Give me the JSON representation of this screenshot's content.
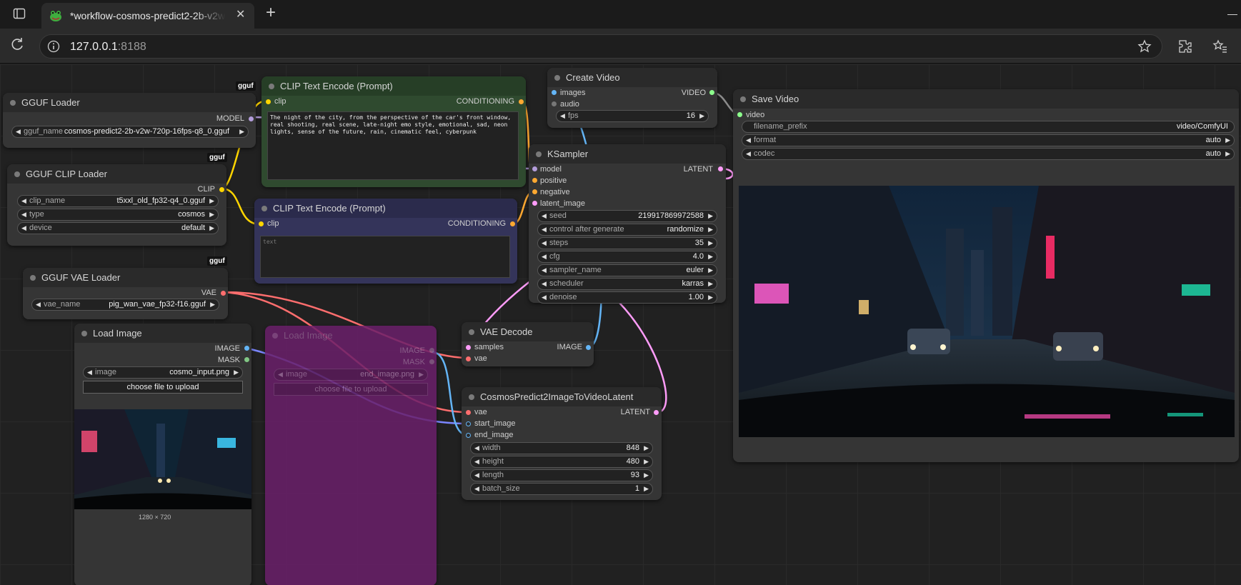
{
  "browser": {
    "tab_title": "*workflow-cosmos-predict2-2b-v2w",
    "url_host": "127.0.0.1",
    "url_port": ":8188",
    "icons": [
      "sidebar-toggle-icon",
      "frog-favicon-icon",
      "close-tab-icon",
      "new-tab-icon",
      "minimize-icon",
      "reload-icon",
      "site-info-icon",
      "bookmark-star-icon",
      "extensions-icon",
      "favorites-icon"
    ]
  },
  "nodes": {
    "gguf_loader": {
      "title": "GGUF Loader",
      "badge": "gguf",
      "out_model": "MODEL",
      "gguf_name_label": "gguf_name",
      "gguf_name_value": "cosmos-predict2-2b-v2w-720p-16fps-q8_0.gguf"
    },
    "clip_loader": {
      "title": "GGUF CLIP Loader",
      "badge": "gguf",
      "out_clip": "CLIP",
      "clip_name_label": "clip_name",
      "clip_name_value": "t5xxl_old_fp32-q4_0.gguf",
      "type_label": "type",
      "type_value": "cosmos",
      "device_label": "device",
      "device_value": "default"
    },
    "vae_loader": {
      "title": "GGUF VAE Loader",
      "badge": "gguf",
      "out_vae": "VAE",
      "vae_name_label": "vae_name",
      "vae_name_value": "pig_wan_vae_fp32-f16.gguf"
    },
    "clip_pos": {
      "title": "CLIP Text Encode (Prompt)",
      "badge": "gguf",
      "in_clip": "clip",
      "out_cond": "CONDITIONING",
      "text": "The night of the city, from the perspective of the car's front window, real shooting, real scene, late-night emo style, emotional, sad, neon lights, sense of the future, rain, cinematic feel, cyberpunk"
    },
    "clip_neg": {
      "title": "CLIP Text Encode (Prompt)",
      "in_clip": "clip",
      "out_cond": "CONDITIONING",
      "placeholder": "text"
    },
    "create_video": {
      "title": "Create Video",
      "in_images": "images",
      "in_audio": "audio",
      "out_video": "VIDEO",
      "fps_label": "fps",
      "fps_value": "16"
    },
    "ksampler": {
      "title": "KSampler",
      "in_model": "model",
      "in_positive": "positive",
      "in_negative": "negative",
      "in_latent": "latent_image",
      "out_latent": "LATENT",
      "seed_label": "seed",
      "seed_value": "219917869972588",
      "cag_label": "control after generate",
      "cag_value": "randomize",
      "steps_label": "steps",
      "steps_value": "35",
      "cfg_label": "cfg",
      "cfg_value": "4.0",
      "sampler_label": "sampler_name",
      "sampler_value": "euler",
      "scheduler_label": "scheduler",
      "scheduler_value": "karras",
      "denoise_label": "denoise",
      "denoise_value": "1.00"
    },
    "save_video": {
      "title": "Save Video",
      "in_video": "video",
      "prefix_label": "filename_prefix",
      "prefix_value": "video/ComfyUI",
      "format_label": "format",
      "format_value": "auto",
      "codec_label": "codec",
      "codec_value": "auto"
    },
    "load_image": {
      "title": "Load Image",
      "out_image": "IMAGE",
      "out_mask": "MASK",
      "image_label": "image",
      "image_value": "cosmo_input.png",
      "upload_label": "choose file to upload",
      "dims": "1280 × 720"
    },
    "load_image_bypassed": {
      "title": "Load Image",
      "out_image": "IMAGE",
      "out_mask": "MASK",
      "image_label": "image",
      "image_value": "end_image.png",
      "upload_label": "choose file to upload"
    },
    "vae_decode": {
      "title": "VAE Decode",
      "in_samples": "samples",
      "in_vae": "vae",
      "out_image": "IMAGE"
    },
    "cosmos_latent": {
      "title": "CosmosPredict2ImageToVideoLatent",
      "in_vae": "vae",
      "in_start": "start_image",
      "in_end": "end_image",
      "out_latent": "LATENT",
      "width_label": "width",
      "width_value": "848",
      "height_label": "height",
      "height_value": "480",
      "length_label": "length",
      "length_value": "93",
      "batch_label": "batch_size",
      "batch_value": "1"
    }
  },
  "colors": {
    "model": "#b39ddb",
    "clip": "#ffd500",
    "conditioning": "#ffa931",
    "vae": "#ff6e6e",
    "image": "#64b5f6",
    "latent": "#ff9cf9",
    "video": "#8cff8c",
    "mask": "#81c784",
    "bypass": "#6a1f6a",
    "positive_node": "#2f4a2f",
    "negative_node": "#34345a"
  }
}
